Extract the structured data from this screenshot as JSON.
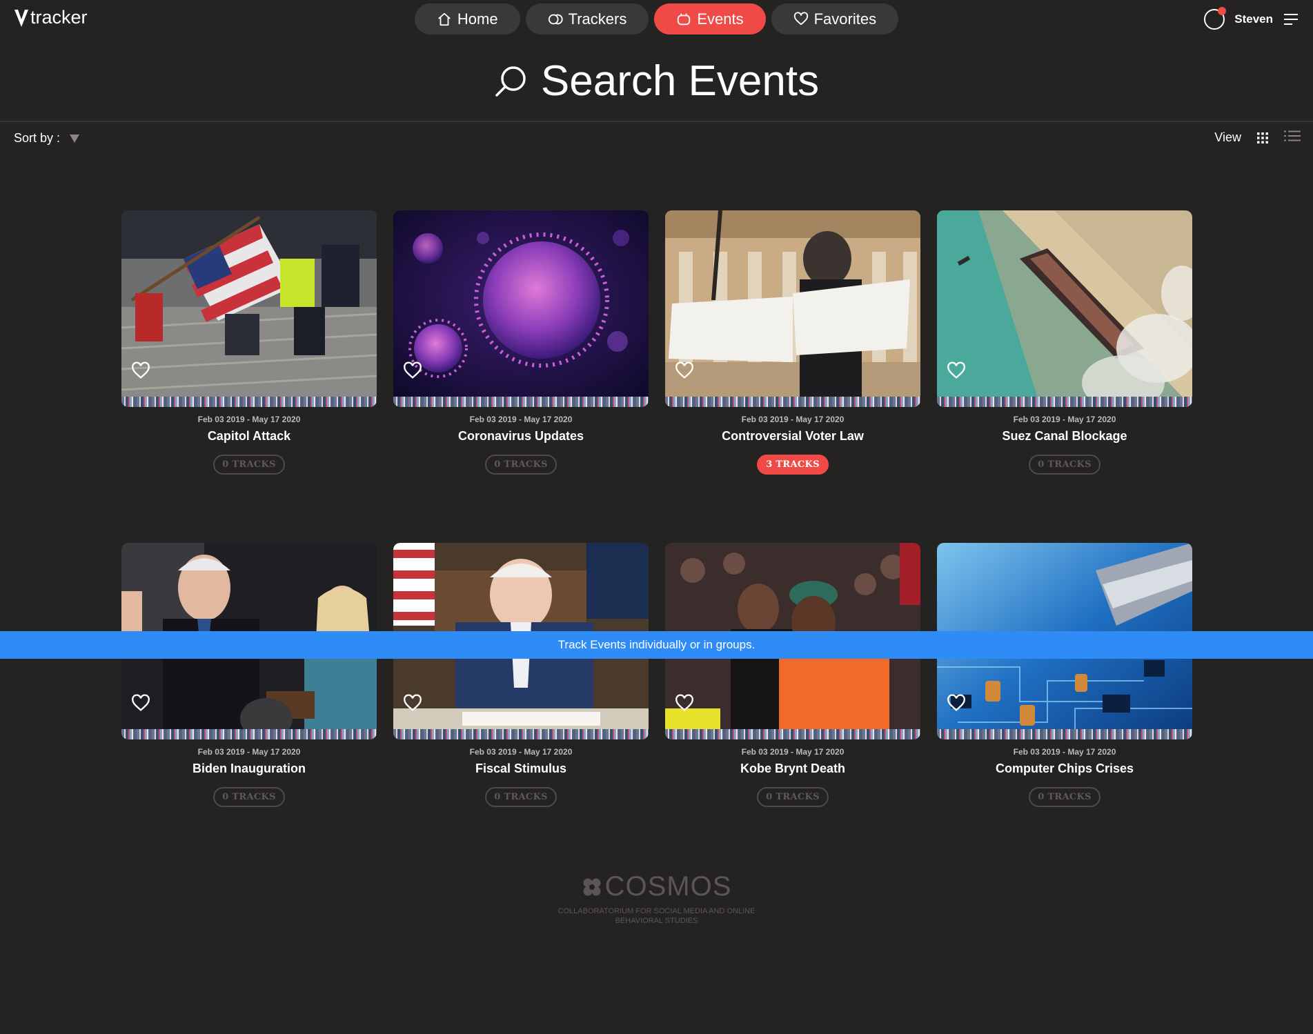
{
  "app": {
    "logo_text": "tracker",
    "user_name": "Steven"
  },
  "nav": [
    {
      "label": "Home",
      "icon": "home-icon",
      "active": false
    },
    {
      "label": "Trackers",
      "icon": "trackers-icon",
      "active": false
    },
    {
      "label": "Events",
      "icon": "events-icon",
      "active": true
    },
    {
      "label": "Favorites",
      "icon": "heart-icon",
      "active": false
    }
  ],
  "page": {
    "title": "Search Events"
  },
  "toolbar": {
    "sort_label": "Sort by :",
    "view_label": "View"
  },
  "events": [
    {
      "title": "Capitol Attack",
      "date": "Feb 03 2019 - May 17 2020",
      "tracks": "0 TRACKS",
      "active": false,
      "image": "capitol-attack-photo"
    },
    {
      "title": "Coronavirus Updates",
      "date": "Feb 03 2019 - May 17 2020",
      "tracks": "0 TRACKS",
      "active": false,
      "image": "coronavirus-photo"
    },
    {
      "title": "Controversial Voter Law",
      "date": "Feb 03 2019 - May 17 2020",
      "tracks": "3 TRACKS",
      "active": true,
      "image": "voter-protest-photo"
    },
    {
      "title": "Suez Canal Blockage",
      "date": "Feb 03 2019 - May 17 2020",
      "tracks": "0 TRACKS",
      "active": false,
      "image": "suez-canal-photo"
    },
    {
      "title": "Biden Inauguration",
      "date": "Feb 03 2019 - May 17 2020",
      "tracks": "0 TRACKS",
      "active": false,
      "image": "inauguration-photo"
    },
    {
      "title": "Fiscal Stimulus",
      "date": "Feb 03 2019 - May 17 2020",
      "tracks": "0 TRACKS",
      "active": false,
      "image": "stimulus-signing-photo"
    },
    {
      "title": "Kobe Brynt Death",
      "date": "Feb 03 2019 - May 17 2020",
      "tracks": "0 TRACKS",
      "active": false,
      "image": "courtside-photo"
    },
    {
      "title": "Computer Chips Crises",
      "date": "Feb 03 2019 - May 17 2020",
      "tracks": "0 TRACKS",
      "active": false,
      "image": "circuit-board-photo"
    }
  ],
  "banner": {
    "text": "Track Events individually or in groups."
  },
  "footer": {
    "brand": "COSMOS",
    "tagline": "COLLABORATORIUM FOR SOCIAL MEDIA AND ONLINE BEHAVIORAL STUDIES"
  },
  "colors": {
    "background": "#252222",
    "accent": "#f04a47",
    "banner": "#2f8bf5",
    "nav_button": "#3b3838"
  }
}
